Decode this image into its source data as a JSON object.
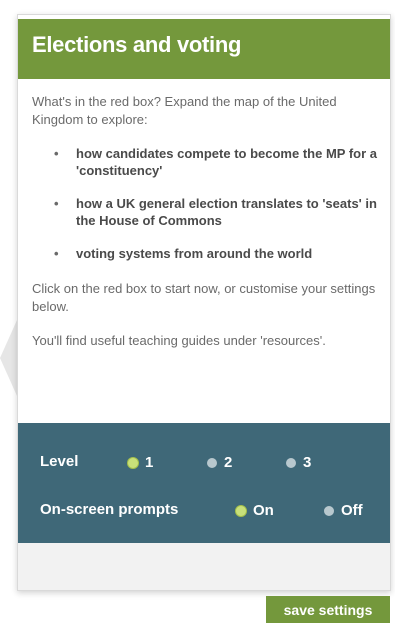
{
  "panel": {
    "title": "Elections and voting",
    "intro": "What's in the red box? Expand the map of the United Kingdom to explore:",
    "bullets": [
      "how candidates compete to become the MP for a 'constituency'",
      "how a UK general election translates to 'seats' in the House of Commons",
      "voting systems from around the world"
    ],
    "bullet_symbol": "•",
    "click_text": "Click on the red box to start now, or customise your settings below.",
    "guides_text": "You'll find useful teaching guides under 'resources'."
  },
  "settings": {
    "level_label": "Level",
    "level_options": [
      "1",
      "2",
      "3"
    ],
    "level_selected": "1",
    "prompts_label": "On-screen prompts",
    "prompts_options": [
      "On",
      "Off"
    ],
    "prompts_selected": "On"
  },
  "buttons": {
    "save_settings": "save settings"
  },
  "colors": {
    "header_green": "#74983c",
    "settings_teal": "#3f6878",
    "selected_radio": "#c8e07a"
  }
}
